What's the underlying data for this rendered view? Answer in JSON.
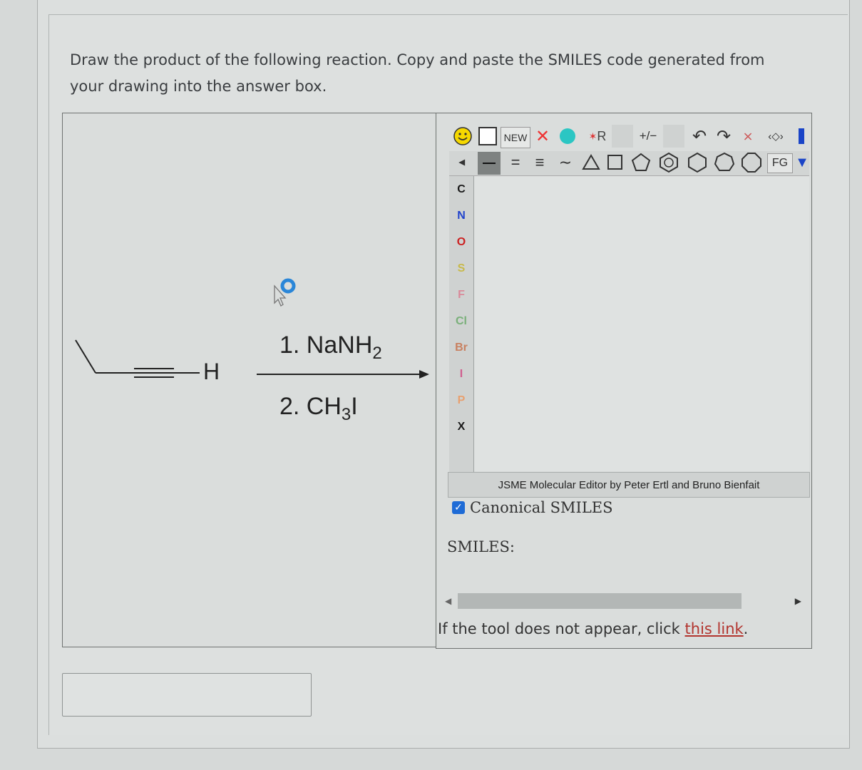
{
  "question": {
    "prompt_line1": "Draw the product of the following reaction. Copy and paste the SMILES code generated from",
    "prompt_line2": "your drawing into the answer box."
  },
  "reaction": {
    "terminal_atom": "H",
    "step1_prefix": "1. NaNH",
    "step1_sub": "2",
    "step2_prefix": "2. CH",
    "step2_sub": "3",
    "step2_suffix": "I"
  },
  "editor": {
    "toolbar_row1": {
      "new_label": "NEW",
      "r_label": "R",
      "charge_label": "+/−"
    },
    "toolbar_row2": {
      "fg_label": "FG"
    },
    "atoms": [
      "C",
      "N",
      "O",
      "S",
      "F",
      "Cl",
      "Br",
      "I",
      "P",
      "X"
    ],
    "atom_colors": [
      "#1a1a1a",
      "#2244cc",
      "#cc2222",
      "#c8b94a",
      "#d98a9a",
      "#7ab07a",
      "#c88060",
      "#d06090",
      "#e8a070",
      "#1a1a1a"
    ],
    "credit": "JSME Molecular Editor by Peter Ertl and Bruno Bienfait",
    "canonical_label": "Canonical SMILES",
    "canonical_checked": true,
    "smiles_label": "SMILES:",
    "smiles_value": ""
  },
  "footer": {
    "fallback_text": "If the tool does not appear, click ",
    "fallback_link": "this link",
    "fallback_end": "."
  },
  "answer": {
    "value": ""
  }
}
